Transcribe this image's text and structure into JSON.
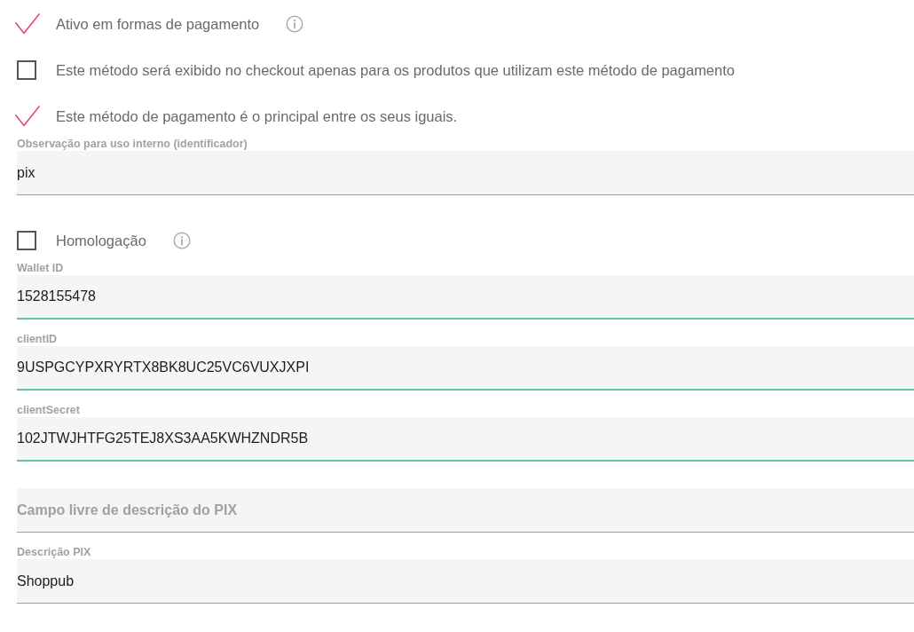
{
  "form": [
    {
      "kind": "checkbox",
      "label": "Ativo em formas de pagamento",
      "checked": true,
      "info": true
    },
    {
      "kind": "checkbox",
      "label": "Este método será exibido no checkout apenas para os produtos que utilizam este método de pagamento",
      "checked": false,
      "info": false
    },
    {
      "kind": "checkbox",
      "label": "Este método de pagamento é o principal entre os seus iguais.",
      "checked": true,
      "info": false
    },
    {
      "kind": "field",
      "label": "Observação para uso interno (identificador)",
      "value": "pix",
      "valid": false
    },
    {
      "kind": "checkbox",
      "label": "Homologação",
      "checked": false,
      "info": true
    },
    {
      "kind": "field",
      "label": "Wallet ID",
      "value": "1528155478",
      "valid": true
    },
    {
      "kind": "field",
      "label": "clientID",
      "value": "9USPGCYPXRYRTX8BK8UC25VC6VUXJXPI",
      "valid": true
    },
    {
      "kind": "field",
      "label": "clientSecret",
      "value": "102JTWJHTFG25TEJ8XS3AA5KWHZNDR5B",
      "valid": true
    },
    {
      "kind": "field",
      "placeholder": "Campo livre de descrição do PIX",
      "valid": false
    },
    {
      "kind": "field",
      "label": "Descrição PIX",
      "value": "Shoppub",
      "valid": false
    }
  ]
}
